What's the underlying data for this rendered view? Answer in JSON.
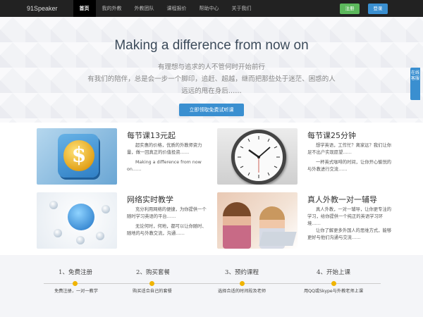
{
  "nav": {
    "brand": "91Speaker",
    "items": [
      {
        "label": "首页",
        "active": true
      },
      {
        "label": "我的外教",
        "active": false
      },
      {
        "label": "外教团队",
        "active": false
      },
      {
        "label": "课程报价",
        "active": false
      },
      {
        "label": "帮助中心",
        "active": false
      },
      {
        "label": "关于我们",
        "active": false
      }
    ],
    "register": "注册",
    "login": "登录"
  },
  "hero": {
    "title": "Making a difference from now on",
    "line1": "有理想与追求的人不管何时开始前行",
    "line2": "有我们的陪伴，总是会一步一个脚印，追赶、超越，继而把那些处于迷茫、困惑的人",
    "line3": "远远的甩在身后……",
    "cta": "立即领取免费试听课"
  },
  "side_tab": "在线客服",
  "features": [
    {
      "title": "每节课13元起",
      "text1": "超实惠的价格，优质的外教师资力量，做一回真正的价值投资……",
      "text2": "Making a difference from now on……"
    },
    {
      "title": "每节课25分钟",
      "text1": "想学英语，工作忙？离家远？我们让你足不出户实现愿望……",
      "text2": "一杯英式咖啡的时间，让你开心愉悦的与外教进行交流……"
    },
    {
      "title": "网络实时教学",
      "text1": "充分利用网络的便捷，为你提供一个随时学习英语的平台……",
      "text2": "无论何时，何地，都可以让你随时、随地的与外教交流，沟通……"
    },
    {
      "title": "真人外教一对一辅导",
      "text1": "真人外教，一对一辅导，让你更专注的学习，给你提供一个纯正的英语学习环境……",
      "text2": "让你了解更多外国人的思维方式，能够更好与他们沟通与交流……"
    }
  ],
  "steps": [
    {
      "title": "1、免费注册",
      "desc": "免费注册，一对一教学"
    },
    {
      "title": "2、购买套餐",
      "desc": "购买适合自己的套餐"
    },
    {
      "title": "3、预约课程",
      "desc": "选择合适的时间段及老师"
    },
    {
      "title": "4、开始上课",
      "desc": "用QQ或Skype与外教老师上课"
    }
  ],
  "colors": {
    "navbar": "#222222",
    "register": "#5cb85c",
    "accent_blue": "#3a8fd0",
    "step_dot": "#f0b400"
  },
  "icons": {
    "dollar": "dollar-icon",
    "clock": "clock-image",
    "globe": "globe-image",
    "people": "tutoring-photo"
  },
  "dollar_glyph": "$"
}
